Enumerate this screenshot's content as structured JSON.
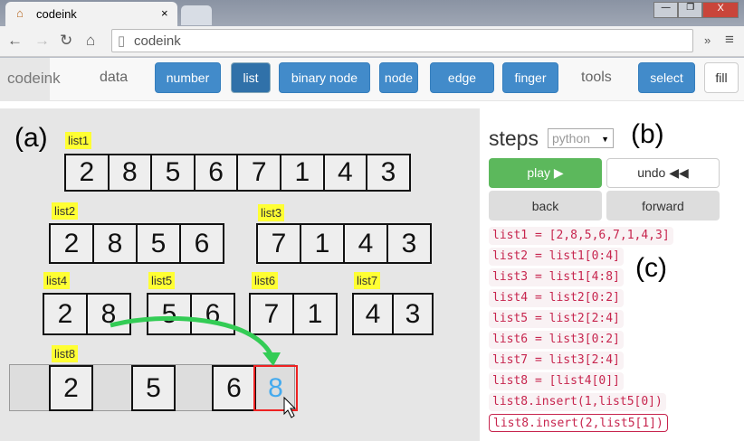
{
  "browser": {
    "tab_title": "codeink",
    "url": "codeink"
  },
  "app": {
    "brand": "codeink",
    "data_label": "data",
    "tools_label": "tools",
    "buttons": [
      "number",
      "list",
      "binary node",
      "node",
      "edge",
      "finger",
      "select",
      "fill"
    ]
  },
  "canvas": {
    "label_a": "(a)",
    "lists": [
      {
        "name": "list1",
        "values": [
          "2",
          "8",
          "5",
          "6",
          "7",
          "1",
          "4",
          "3"
        ]
      },
      {
        "name": "list2",
        "values": [
          "2",
          "8",
          "5",
          "6"
        ]
      },
      {
        "name": "list3",
        "values": [
          "7",
          "1",
          "4",
          "3"
        ]
      },
      {
        "name": "list4",
        "values": [
          "2",
          "8"
        ]
      },
      {
        "name": "list5",
        "values": [
          "5",
          "6"
        ]
      },
      {
        "name": "list6",
        "values": [
          "7",
          "1"
        ]
      },
      {
        "name": "list7",
        "values": [
          "4",
          "3"
        ]
      },
      {
        "name": "list8",
        "values": [
          "2",
          "5",
          "6",
          "8"
        ]
      }
    ]
  },
  "steps": {
    "title": "steps",
    "language": "python",
    "label_b": "(b)",
    "label_c": "(c)",
    "play": "play ▶",
    "undo": "undo ◀◀",
    "back": "back",
    "forward": "forward",
    "code": [
      "list1 = [2,8,5,6,7,1,4,3]",
      "list2 = list1[0:4]",
      "list3 = list1[4:8]",
      "list4 = list2[0:2]",
      "list5 = list2[2:4]",
      "list6 = list3[0:2]",
      "list7 = list3[2:4]",
      "list8 = [list4[0]]",
      "list8.insert(1,list5[0])",
      "list8.insert(2,list5[1])"
    ]
  },
  "colors": {
    "primary": "#428bca",
    "play": "#5cb85c",
    "code": "#c7254e",
    "tag": "#ffff33",
    "arrow": "#33cc55",
    "highlight": "#ee2222",
    "new_value": "#44aaee"
  }
}
